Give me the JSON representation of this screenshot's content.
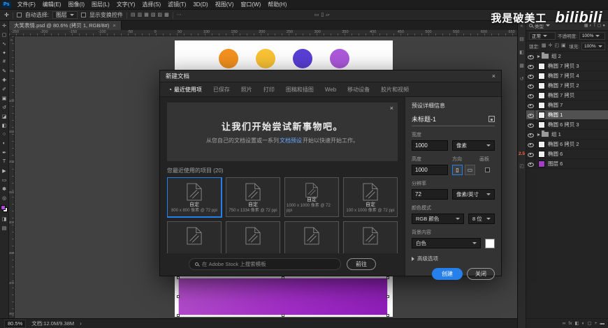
{
  "colors": {
    "accent_blue": "#2680EB",
    "selection_purple": "#A32BC9",
    "watermark": "#FFFFFF"
  },
  "watermark": {
    "text": "我是破美工",
    "logo": "bilibili"
  },
  "menu": {
    "logo": "Ps",
    "items": [
      "文件(F)",
      "编辑(E)",
      "图像(I)",
      "图层(L)",
      "文字(Y)",
      "选择(S)",
      "滤镜(T)",
      "3D(D)",
      "视图(V)",
      "窗口(W)",
      "帮助(H)"
    ]
  },
  "options": {
    "tool_glyph": "✛",
    "auto_select_label": "自动选择:",
    "auto_select_value": "图层",
    "show_transform_label": "显示变换控件",
    "align_icons": [
      {
        "name": "align-left-icon",
        "glyph": "▤"
      },
      {
        "name": "align-center-icon",
        "glyph": "▥"
      },
      {
        "name": "align-right-icon",
        "glyph": "▦"
      },
      {
        "name": "distribute-top-icon",
        "glyph": "▧"
      },
      {
        "name": "distribute-middle-icon",
        "glyph": "▨"
      },
      {
        "name": "distribute-bottom-icon",
        "glyph": "▩"
      }
    ],
    "more_glyph": "⋯",
    "workspace_icons": [
      {
        "name": "workspace-icon-a",
        "glyph": "▭"
      },
      {
        "name": "workspace-icon-b",
        "glyph": "▯"
      },
      {
        "name": "workspace-icon-c",
        "glyph": "▱"
      }
    ]
  },
  "doc_tab": {
    "title": "大笑表情.psd @ 80.6% (拷贝 1, RGB/8#)",
    "close": "×"
  },
  "toolbar": {
    "fg_color": "#b04ad6",
    "bg_color": "#ffffff",
    "tools": [
      {
        "name": "move-tool",
        "glyph": "✛"
      },
      {
        "name": "marquee-tool",
        "glyph": "▢"
      },
      {
        "name": "lasso-tool",
        "glyph": "∿"
      },
      {
        "name": "quick-select-tool",
        "glyph": "✦"
      },
      {
        "name": "crop-tool",
        "glyph": "#"
      },
      {
        "name": "eyedropper-tool",
        "glyph": "✎"
      },
      {
        "name": "healing-brush-tool",
        "glyph": "✚"
      },
      {
        "name": "brush-tool",
        "glyph": "✐"
      },
      {
        "name": "clone-stamp-tool",
        "glyph": "▣"
      },
      {
        "name": "history-brush-tool",
        "glyph": "↺"
      },
      {
        "name": "eraser-tool",
        "glyph": "◪"
      },
      {
        "name": "gradient-tool",
        "glyph": "◧"
      },
      {
        "name": "blur-tool",
        "glyph": "○"
      },
      {
        "name": "dodge-tool",
        "glyph": "◐"
      },
      {
        "name": "pen-tool",
        "glyph": "✒"
      },
      {
        "name": "type-tool",
        "glyph": "T"
      },
      {
        "name": "path-select-tool",
        "glyph": "▶"
      },
      {
        "name": "shape-tool",
        "glyph": "▭"
      },
      {
        "name": "hand-tool",
        "glyph": "✽"
      },
      {
        "name": "zoom-tool",
        "glyph": "◎"
      }
    ],
    "bottom_icons": [
      {
        "name": "quick-mask-icon",
        "glyph": "◨"
      },
      {
        "name": "screen-mode-icon",
        "glyph": "▤"
      }
    ]
  },
  "rulers": {
    "h_numbers": [
      "-250",
      "-200",
      "-150",
      "-100",
      "-50",
      "0",
      "50",
      "100",
      "150",
      "200",
      "250",
      "300",
      "350",
      "400",
      "450",
      "500",
      "550",
      "600",
      "650"
    ],
    "v_numbers": [
      "0",
      "50",
      "100",
      "150",
      "200",
      "250",
      "300",
      "350",
      "400",
      "450"
    ]
  },
  "canvas": {
    "circles": [
      {
        "name": "orange-circle",
        "color": "#F5921E"
      },
      {
        "name": "yellow-circle",
        "color": "#FBC335"
      },
      {
        "name": "indigo-circle",
        "color": "#5A3FD6"
      },
      {
        "name": "violet-circle",
        "color": "#AE59DD"
      }
    ],
    "selection_rect": {
      "background": "linear-gradient(120deg,#b44ecb 0%,#a02cc5 55%,#8e1db8 100%)"
    }
  },
  "status": {
    "zoom": "80.5%",
    "doc_info": "文档:12.0M/9.38M",
    "chevron": "›"
  },
  "panels": {
    "strip_icons": [
      {
        "name": "collapse-panels-icon",
        "glyph": "«"
      },
      {
        "name": "color-panel-icon",
        "glyph": "▤"
      },
      {
        "name": "adjustments-panel-icon",
        "glyph": "◧"
      },
      {
        "name": "libraries-panel-icon",
        "glyph": "▦"
      },
      {
        "name": "history-panel-icon",
        "glyph": "↺"
      }
    ],
    "strip_badge": "2.5",
    "strip_icons_lower": [
      {
        "name": "properties-panel-icon",
        "glyph": "◰"
      }
    ],
    "filter_label": "类型",
    "filter_icons": [
      {
        "name": "filter-pixel-layers-icon",
        "glyph": "▦"
      },
      {
        "name": "filter-adjustment-layers-icon",
        "glyph": "◐"
      },
      {
        "name": "filter-type-layers-icon",
        "glyph": "T"
      },
      {
        "name": "filter-shape-layers-icon",
        "glyph": "▢"
      },
      {
        "name": "filter-smart-objects-icon",
        "glyph": "●"
      }
    ],
    "blend_mode": "正常",
    "opacity_label": "不透明度:",
    "opacity_value": "100%",
    "lock_label": "锁定:",
    "lock_icons": [
      {
        "name": "lock-transparency-icon",
        "glyph": "▩"
      },
      {
        "name": "lock-position-icon",
        "glyph": "✛"
      },
      {
        "name": "lock-image-icon",
        "glyph": "◰"
      },
      {
        "name": "lock-all-icon",
        "glyph": "▣"
      }
    ],
    "fill_label": "填充:",
    "fill_value": "100%",
    "layers": [
      {
        "label": "组 2",
        "group": true
      },
      {
        "label": "椭圆 7 拷贝 3",
        "thumb": "#f0f0f0"
      },
      {
        "label": "椭圆 7 拷贝 4",
        "thumb": "#f0f0f0"
      },
      {
        "label": "椭圆 7 拷贝 2",
        "thumb": "#f0f0f0"
      },
      {
        "label": "椭圆 7 拷贝",
        "thumb": "#f0f0f0"
      },
      {
        "label": "椭圆 7",
        "thumb": "#f0f0f0"
      },
      {
        "label": "椭圆 1",
        "thumb": "#f0f0f0",
        "selected": true
      },
      {
        "label": "椭圆 6 拷贝 3",
        "thumb": "#f0f0f0"
      },
      {
        "label": "组 1",
        "group": true
      },
      {
        "label": "椭圆 6 拷贝 2",
        "thumb": "#f0f0f0"
      },
      {
        "label": "椭圆 6",
        "thumb": "#f0f0f0"
      },
      {
        "label": "图层 6",
        "thumb": "#a53ec6"
      }
    ],
    "footer_icons": [
      {
        "name": "link-layers-icon",
        "glyph": "∞"
      },
      {
        "name": "layer-style-icon",
        "glyph": "fx"
      },
      {
        "name": "add-mask-icon",
        "glyph": "◧"
      },
      {
        "name": "adjustment-layer-icon",
        "glyph": "◐"
      },
      {
        "name": "new-group-icon",
        "glyph": "▢"
      },
      {
        "name": "new-layer-icon",
        "glyph": "+"
      },
      {
        "name": "delete-layer-icon",
        "glyph": "▬"
      }
    ]
  },
  "dialog": {
    "title": "新建文档",
    "close_glyph": "×",
    "tabs": [
      {
        "label": "最近使用项",
        "icon": "◔",
        "active": true
      },
      {
        "label": "已保存"
      },
      {
        "label": "照片"
      },
      {
        "label": "打印"
      },
      {
        "label": "图稿和插图"
      },
      {
        "label": "Web"
      },
      {
        "label": "移动设备"
      },
      {
        "label": "胶片和视频"
      }
    ],
    "hero": {
      "title": "让我们开始尝试新事物吧。",
      "subtitle_pre": "从您自己的文档设置或一系列",
      "subtitle_link": "文档预设",
      "subtitle_post": "开始以快速开始工作。",
      "close_glyph": "×"
    },
    "recent_label": "您最近使用的项目 (20)",
    "cards": [
      {
        "name": "自定",
        "size": "800 x 800 像素 @ 72 ppi",
        "selected": true
      },
      {
        "name": "自定",
        "size": "750 x 1334 像素 @ 72 ppi"
      },
      {
        "name": "自定",
        "size": "1000 x 1000 像素 @ 72 ppi"
      },
      {
        "name": "自定",
        "size": "100 x 1000 像素 @ 72 ppi"
      },
      {
        "name": "",
        "size": ""
      },
      {
        "name": "",
        "size": ""
      },
      {
        "name": "",
        "size": ""
      },
      {
        "name": "",
        "size": ""
      }
    ],
    "search": {
      "placeholder": "在 Adobe Stock 上搜索模板",
      "button": "前往"
    },
    "details": {
      "panel_title": "预设详细信息",
      "doc_name": "未标题-1",
      "width_label": "宽度",
      "width": "1000",
      "width_unit": "像素",
      "height_label": "高度",
      "height": "1000",
      "orientation_label": "方向",
      "portrait_glyph": "▯",
      "landscape_glyph": "▭",
      "artboard_label": "画板",
      "resolution_label": "分辨率",
      "resolution": "72",
      "resolution_unit": "像素/英寸",
      "color_mode_label": "颜色模式",
      "color_mode": "RGB 颜色",
      "bit_depth": "8 位",
      "background_label": "背景内容",
      "background": "白色",
      "advanced_label": "高级选项",
      "create_button": "创建",
      "close_button": "关闭"
    }
  }
}
